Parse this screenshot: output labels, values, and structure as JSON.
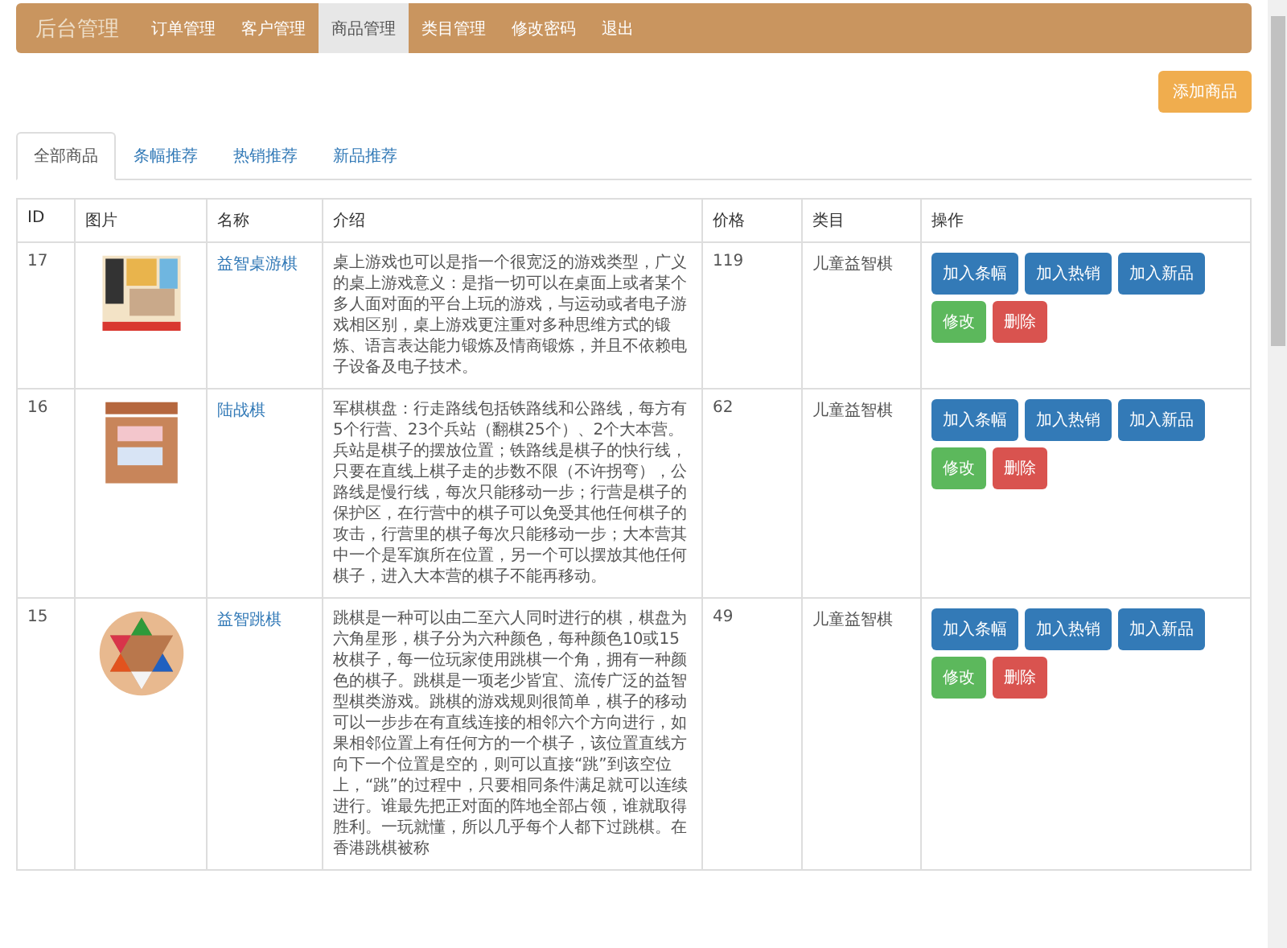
{
  "navbar": {
    "brand": "后台管理",
    "items": [
      {
        "label": "订单管理",
        "selected": false
      },
      {
        "label": "客户管理",
        "selected": false
      },
      {
        "label": "商品管理",
        "selected": true
      },
      {
        "label": "类目管理",
        "selected": false
      },
      {
        "label": "修改密码",
        "selected": false
      },
      {
        "label": "退出",
        "selected": false
      }
    ]
  },
  "add_button": "添加商品",
  "tabs": [
    {
      "label": "全部商品",
      "selected": true
    },
    {
      "label": "条幅推荐",
      "selected": false
    },
    {
      "label": "热销推荐",
      "selected": false
    },
    {
      "label": "新品推荐",
      "selected": false
    }
  ],
  "table": {
    "columns": [
      "ID",
      "图片",
      "名称",
      "介绍",
      "价格",
      "类目",
      "操作"
    ],
    "rows": [
      {
        "id": "17",
        "kind": "board",
        "name": "益智桌游棋",
        "description": "桌上游戏也可以是指一个很宽泛的游戏类型，广义的桌上游戏意义：是指一切可以在桌面上或者某个多人面对面的平台上玩的游戏，与运动或者电子游戏相区别，桌上游戏更注重对多种思维方式的锻炼、语言表达能力锻炼及情商锻炼，并且不依赖电子设备及电子技术。",
        "price": "119",
        "category": "儿童益智棋",
        "actions": [
          {
            "label": "加入条幅",
            "kind": "primary"
          },
          {
            "label": "加入热销",
            "kind": "primary"
          },
          {
            "label": "加入新品",
            "kind": "primary"
          },
          {
            "label": "修改",
            "kind": "success"
          },
          {
            "label": "删除",
            "kind": "danger"
          }
        ]
      },
      {
        "id": "16",
        "kind": "box",
        "name": "陆战棋",
        "description": "军棋棋盘：行走路线包括铁路线和公路线，每方有5个行营、23个兵站（翻棋25个）、2个大本营。兵站是棋子的摆放位置；铁路线是棋子的快行线，只要在直线上棋子走的步数不限（不许拐弯），公路线是慢行线，每次只能移动一步；行营是棋子的保护区，在行营中的棋子可以免受其他任何棋子的攻击，行营里的棋子每次只能移动一步；大本营其中一个是军旗所在位置，另一个可以摆放其他任何棋子，进入大本营的棋子不能再移动。",
        "price": "62",
        "category": "儿童益智棋",
        "actions": [
          {
            "label": "加入条幅",
            "kind": "primary"
          },
          {
            "label": "加入热销",
            "kind": "primary"
          },
          {
            "label": "加入新品",
            "kind": "primary"
          },
          {
            "label": "修改",
            "kind": "success"
          },
          {
            "label": "删除",
            "kind": "danger"
          }
        ]
      },
      {
        "id": "15",
        "kind": "star",
        "name": "益智跳棋",
        "description": "跳棋是一种可以由二至六人同时进行的棋，棋盘为六角星形，棋子分为六种颜色，每种颜色10或15枚棋子，每一位玩家使用跳棋一个角，拥有一种颜色的棋子。跳棋是一项老少皆宜、流传广泛的益智型棋类游戏。跳棋的游戏规则很简单，棋子的移动可以一步步在有直线连接的相邻六个方向进行，如果相邻位置上有任何方的一个棋子，该位置直线方向下一个位置是空的，则可以直接“跳”到该空位上，“跳”的过程中，只要相同条件满足就可以连续进行。谁最先把正对面的阵地全部占领，谁就取得胜利。一玩就懂，所以几乎每个人都下过跳棋。在香港跳棋被称",
        "price": "49",
        "category": "儿童益智棋",
        "actions": [
          {
            "label": "加入条幅",
            "kind": "primary"
          },
          {
            "label": "加入热销",
            "kind": "primary"
          },
          {
            "label": "加入新品",
            "kind": "primary"
          },
          {
            "label": "修改",
            "kind": "success"
          },
          {
            "label": "删除",
            "kind": "danger"
          }
        ]
      }
    ]
  }
}
